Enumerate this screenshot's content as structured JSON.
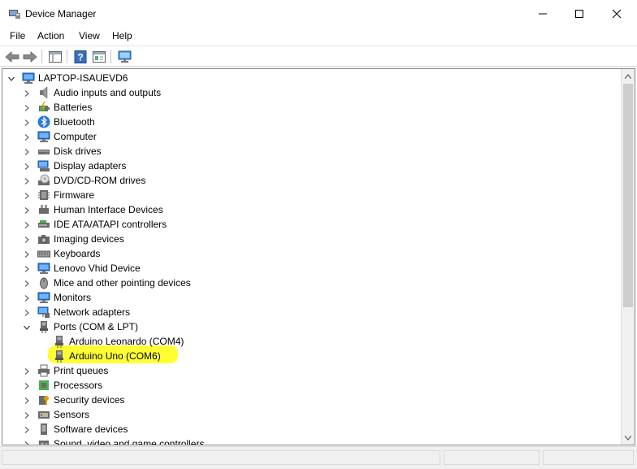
{
  "window": {
    "title": "Device Manager"
  },
  "menu": [
    "File",
    "Action",
    "View",
    "Help"
  ],
  "tree": {
    "root": "LAPTOP-ISAUEVD6",
    "items": [
      {
        "label": "Audio inputs and outputs",
        "icon": "speaker-icon",
        "expanded": false
      },
      {
        "label": "Batteries",
        "icon": "battery-icon",
        "expanded": false
      },
      {
        "label": "Bluetooth",
        "icon": "bluetooth-icon",
        "expanded": false
      },
      {
        "label": "Computer",
        "icon": "computer-icon",
        "expanded": false
      },
      {
        "label": "Disk drives",
        "icon": "disk-drive-icon",
        "expanded": false
      },
      {
        "label": "Display adapters",
        "icon": "display-adapter-icon",
        "expanded": false
      },
      {
        "label": "DVD/CD-ROM drives",
        "icon": "dvd-drive-icon",
        "expanded": false
      },
      {
        "label": "Firmware",
        "icon": "firmware-icon",
        "expanded": false
      },
      {
        "label": "Human Interface Devices",
        "icon": "hid-icon",
        "expanded": false
      },
      {
        "label": "IDE ATA/ATAPI controllers",
        "icon": "ide-controller-icon",
        "expanded": false
      },
      {
        "label": "Imaging devices",
        "icon": "camera-icon",
        "expanded": false
      },
      {
        "label": "Keyboards",
        "icon": "keyboard-icon",
        "expanded": false
      },
      {
        "label": "Lenovo Vhid Device",
        "icon": "monitor-icon",
        "expanded": false
      },
      {
        "label": "Mice and other pointing devices",
        "icon": "mouse-icon",
        "expanded": false
      },
      {
        "label": "Monitors",
        "icon": "monitor-icon",
        "expanded": false
      },
      {
        "label": "Network adapters",
        "icon": "network-adapter-icon",
        "expanded": false
      },
      {
        "label": "Ports (COM & LPT)",
        "icon": "port-icon",
        "expanded": true,
        "children": [
          {
            "label": "Arduino Leonardo (COM4)",
            "icon": "port-icon"
          },
          {
            "label": "Arduino Uno (COM6)",
            "icon": "port-icon",
            "highlighted": true
          }
        ]
      },
      {
        "label": "Print queues",
        "icon": "printer-icon",
        "expanded": false
      },
      {
        "label": "Processors",
        "icon": "processor-icon",
        "expanded": false
      },
      {
        "label": "Security devices",
        "icon": "security-device-icon",
        "expanded": false
      },
      {
        "label": "Sensors",
        "icon": "sensor-icon",
        "expanded": false
      },
      {
        "label": "Software devices",
        "icon": "software-device-icon",
        "expanded": false
      },
      {
        "label": "Sound, video and game controllers",
        "icon": "sound-controller-icon",
        "expanded": false
      }
    ]
  },
  "colors": {
    "highlight": "#ffff33",
    "icon_blue": "#2b78d8",
    "icon_gray": "#6a6a6a"
  }
}
